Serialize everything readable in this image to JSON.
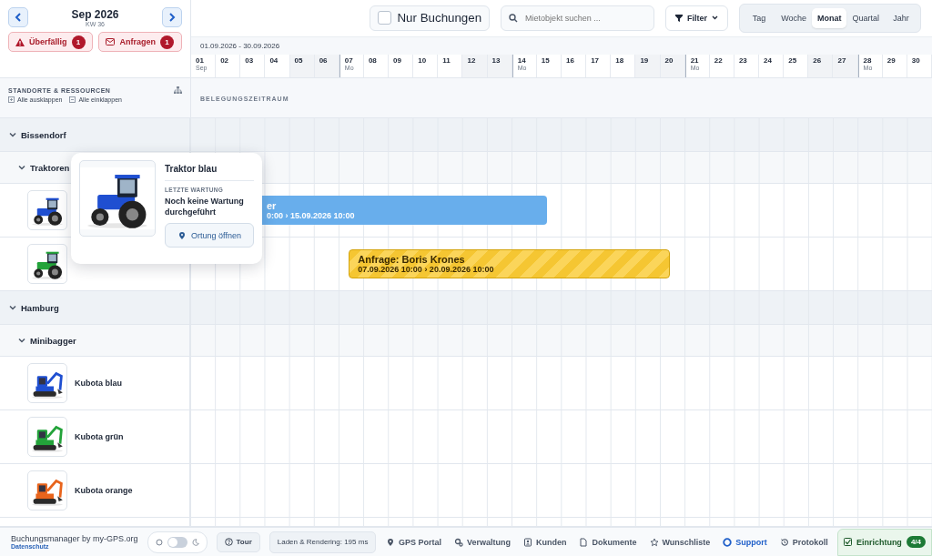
{
  "calendar": {
    "month": "Sep 2026",
    "week": "KW 36"
  },
  "alerts": [
    {
      "label": "Überfällig",
      "count": "1"
    },
    {
      "label": "Anfragen",
      "count": "1"
    }
  ],
  "toolbar": {
    "only_bookings": {
      "label": "Nur Buchungen",
      "checked": false
    },
    "search": {
      "placeholder": "Mietobjekt suchen ..."
    },
    "filter": {
      "label": "Filter"
    },
    "views": [
      {
        "label": "Tag",
        "selected": false
      },
      {
        "label": "Woche",
        "selected": false
      },
      {
        "label": "Monat",
        "selected": true
      },
      {
        "label": "Quartal",
        "selected": false
      },
      {
        "label": "Jahr",
        "selected": false
      }
    ]
  },
  "range": "01.09.2026 - 30.09.2026",
  "days": [
    {
      "label": "01",
      "sub": "Sep",
      "weekend": false,
      "week_start": false
    },
    {
      "label": "02",
      "weekend": false,
      "week_start": false
    },
    {
      "label": "03",
      "weekend": false,
      "week_start": false
    },
    {
      "label": "04",
      "weekend": false,
      "week_start": false
    },
    {
      "label": "05",
      "weekend": true,
      "week_start": false
    },
    {
      "label": "06",
      "weekend": true,
      "week_start": false
    },
    {
      "label": "07",
      "sub": "Mo",
      "weekend": false,
      "week_start": true
    },
    {
      "label": "08",
      "weekend": false,
      "week_start": false
    },
    {
      "label": "09",
      "weekend": false,
      "week_start": false
    },
    {
      "label": "10",
      "weekend": false,
      "week_start": false
    },
    {
      "label": "11",
      "weekend": false,
      "week_start": false
    },
    {
      "label": "12",
      "weekend": true,
      "week_start": false
    },
    {
      "label": "13",
      "weekend": true,
      "week_start": false
    },
    {
      "label": "14",
      "sub": "Mo",
      "weekend": false,
      "week_start": true
    },
    {
      "label": "15",
      "weekend": false,
      "week_start": false
    },
    {
      "label": "16",
      "weekend": false,
      "week_start": false
    },
    {
      "label": "17",
      "weekend": false,
      "week_start": false
    },
    {
      "label": "18",
      "weekend": false,
      "week_start": false
    },
    {
      "label": "19",
      "weekend": true,
      "week_start": false
    },
    {
      "label": "20",
      "weekend": true,
      "week_start": false
    },
    {
      "label": "21",
      "sub": "Mo",
      "weekend": false,
      "week_start": true
    },
    {
      "label": "22",
      "weekend": false,
      "week_start": false
    },
    {
      "label": "23",
      "weekend": false,
      "week_start": false
    },
    {
      "label": "24",
      "weekend": false,
      "week_start": false
    },
    {
      "label": "25",
      "weekend": false,
      "week_start": false
    },
    {
      "label": "26",
      "weekend": true,
      "week_start": false
    },
    {
      "label": "27",
      "weekend": true,
      "week_start": false
    },
    {
      "label": "28",
      "sub": "Mo",
      "weekend": false,
      "week_start": true
    },
    {
      "label": "29",
      "weekend": false,
      "week_start": false
    },
    {
      "label": "30",
      "weekend": false,
      "week_start": false
    }
  ],
  "resources_header": {
    "title": "STANDORTE & RESSOURCEN",
    "expand_all": "Alle ausklappen",
    "collapse_all": "Alle einklappen"
  },
  "timeline_header": "BELEGUNGSZEITRAUM",
  "locations": [
    {
      "name": "Bissendorf",
      "expanded": true,
      "children": [
        {
          "name": "Traktoren",
          "expanded": true,
          "children": [
            {
              "image": {
                "kind": "picture"
              },
              "bookings": [
                {
                  "kind": "booking",
                  "title": "er",
                  "dates": "0:00 › 15.09.2026 10:00"
                }
              ]
            },
            {
              "image": {
                "kind": "picture"
              },
              "bookings": [
                {
                  "kind": "request",
                  "title": "Anfrage: Boris Krones",
                  "dates": "07.09.2026 10:00 › 20.09.2026 10:00"
                }
              ]
            }
          ]
        }
      ]
    },
    {
      "name": "Hamburg",
      "expanded": true,
      "children": [
        {
          "name": "Minibagger",
          "expanded": true,
          "children": [
            {
              "name": "Kubota blau",
              "image": {
                "kind": "picture"
              }
            },
            {
              "name": "Kubota grün",
              "image": {
                "kind": "picture"
              }
            },
            {
              "name": "Kubota orange",
              "image": {
                "kind": "picture"
              }
            }
          ]
        }
      ]
    }
  ],
  "popup": {
    "image": {
      "kind": "picture"
    },
    "title": "Traktor blau",
    "label": "LETZTE WARTUNG",
    "value": "Noch keine Wartung durchgeführt",
    "button": "Ortung öffnen"
  },
  "footer": {
    "brand": "Buchungsmanager by my-GPS.org",
    "privacy": "Datenschutz",
    "dark_mode": false,
    "tour": "Tour",
    "timing": "Laden & Rendering: 195 ms",
    "links": [
      {
        "label": "GPS Portal",
        "accent": false
      },
      {
        "label": "Verwaltung",
        "accent": false
      },
      {
        "label": "Kunden",
        "accent": false
      },
      {
        "label": "Dokumente",
        "accent": false
      },
      {
        "label": "Wunschliste",
        "accent": false
      },
      {
        "label": "Support",
        "accent": true
      },
      {
        "label": "Protokoll",
        "accent": false
      }
    ],
    "setup": {
      "label": "Einrichtung",
      "count": "4/4"
    }
  }
}
